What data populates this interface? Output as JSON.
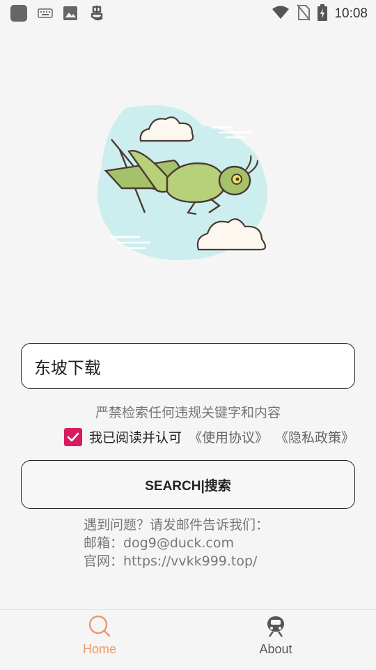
{
  "status_bar": {
    "time": "10:08",
    "icons_left": [
      "app-square-icon",
      "keyboard-icon",
      "image-icon",
      "bug-icon"
    ],
    "icons_right": [
      "wifi-icon",
      "no-sim-icon",
      "battery-charging-icon"
    ]
  },
  "search": {
    "value": "东坡下载",
    "warning": "严禁检索任何违规关键字和内容"
  },
  "agreement": {
    "checked": true,
    "text": "我已阅读并认可",
    "terms_link": "《使用协议》",
    "privacy_link": "《隐私政策》"
  },
  "search_button": {
    "label": "SEARCH|搜索"
  },
  "contact": {
    "line1": "遇到问题？请发邮件告诉我们：",
    "line2": "邮箱：dog9@duck.com",
    "line3": "官网：https://vvkk999.top/"
  },
  "bottom_nav": {
    "home_label": "Home",
    "about_label": "About"
  },
  "colors": {
    "accent": "#d81b60",
    "home_active": "#e89a6d",
    "background": "#f5f5f5"
  }
}
